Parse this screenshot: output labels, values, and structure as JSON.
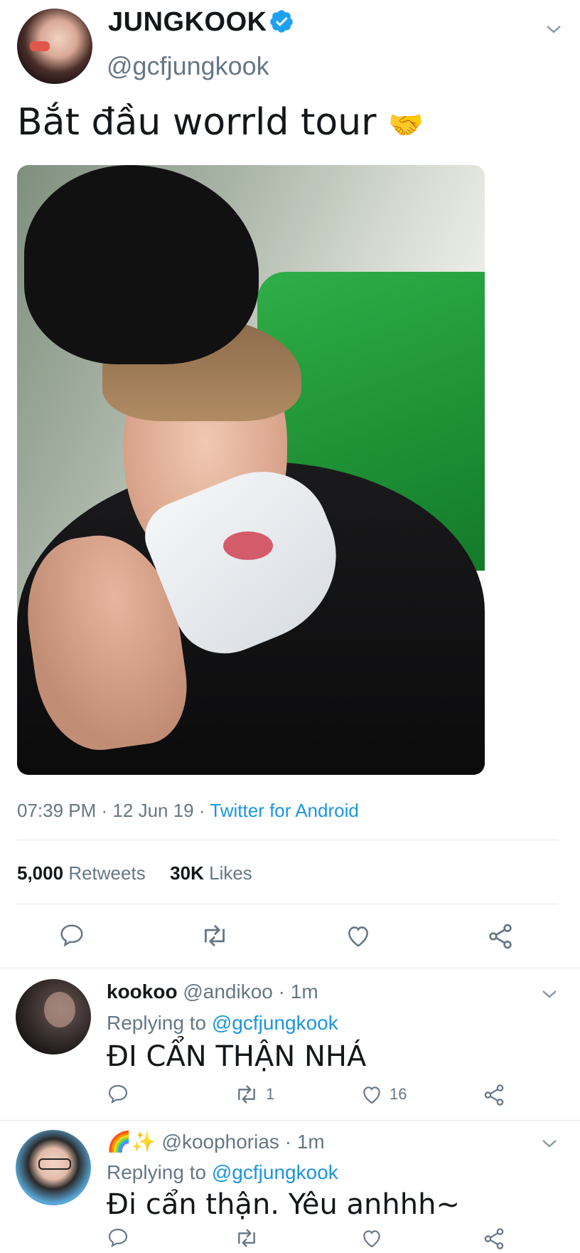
{
  "tweet": {
    "author_name": "JUNGKOOK",
    "author_handle": "@gcfjungkook",
    "text": "Bắt đầu worrld tour",
    "emoji": "🤝",
    "time": "07:39 PM",
    "date": "12 Jun 19",
    "source": "Twitter for Android",
    "retweets_count": "5,000",
    "retweets_label": "Retweets",
    "likes_count": "30K",
    "likes_label": "Likes"
  },
  "replies": [
    {
      "name": "kookoo",
      "handle": "@andikoo",
      "time": "1m",
      "replying_prefix": "Replying to",
      "replying_to": "@gcfjungkook",
      "text": "ĐI CẨN THẬN NHÁ",
      "retweets": "1",
      "likes": "16"
    },
    {
      "name_emoji": "🌈✨",
      "handle": "@koophorias",
      "time": "1m",
      "replying_prefix": "Replying to",
      "replying_to": "@gcfjungkook",
      "text": "Đi cẩn thận. Yêu anhhh~",
      "retweets": "",
      "likes": ""
    }
  ],
  "icons": {
    "verified": "verified-badge-icon",
    "chevron": "chevron-down-icon",
    "reply": "reply-icon",
    "retweet": "retweet-icon",
    "like": "heart-icon",
    "share": "share-icon"
  },
  "colors": {
    "accent": "#1b95e0",
    "muted": "#657786",
    "divider": "#e1e8ed",
    "text": "#14171a"
  }
}
